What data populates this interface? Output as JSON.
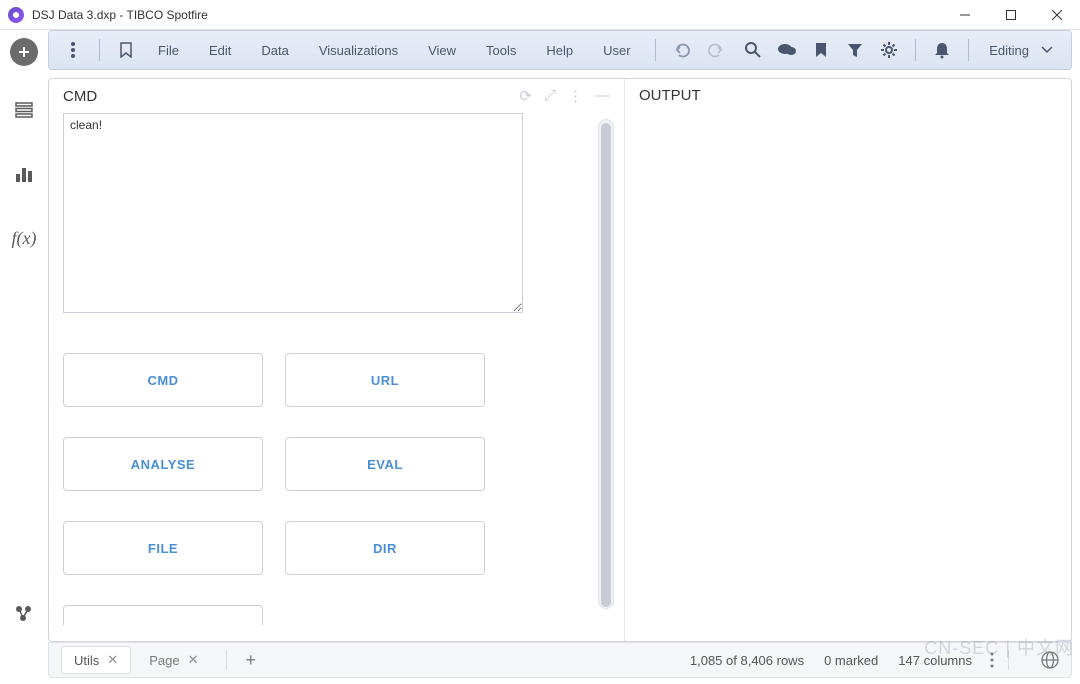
{
  "window": {
    "title": "DSJ Data 3.dxp - TIBCO Spotfire"
  },
  "menus": [
    "File",
    "Edit",
    "Data",
    "Visualizations",
    "View",
    "Tools",
    "Help",
    "User"
  ],
  "mode": {
    "label": "Editing"
  },
  "panels": {
    "cmd": {
      "title": "CMD",
      "value": "clean!"
    },
    "output": {
      "title": "OUTPUT"
    }
  },
  "buttons": [
    {
      "key": "cmd",
      "label": "CMD"
    },
    {
      "key": "url",
      "label": "URL"
    },
    {
      "key": "analyse",
      "label": "ANALYSE"
    },
    {
      "key": "eval",
      "label": "EVAL"
    },
    {
      "key": "file",
      "label": "FILE"
    },
    {
      "key": "dir",
      "label": "DIR"
    }
  ],
  "tabs": [
    {
      "name": "Utils",
      "active": true
    },
    {
      "name": "Page",
      "active": false
    }
  ],
  "status": {
    "rows": "1,085 of 8,406 rows",
    "marked": "0 marked",
    "columns": "147 columns"
  },
  "watermark": "CN-SEC | 中文网"
}
